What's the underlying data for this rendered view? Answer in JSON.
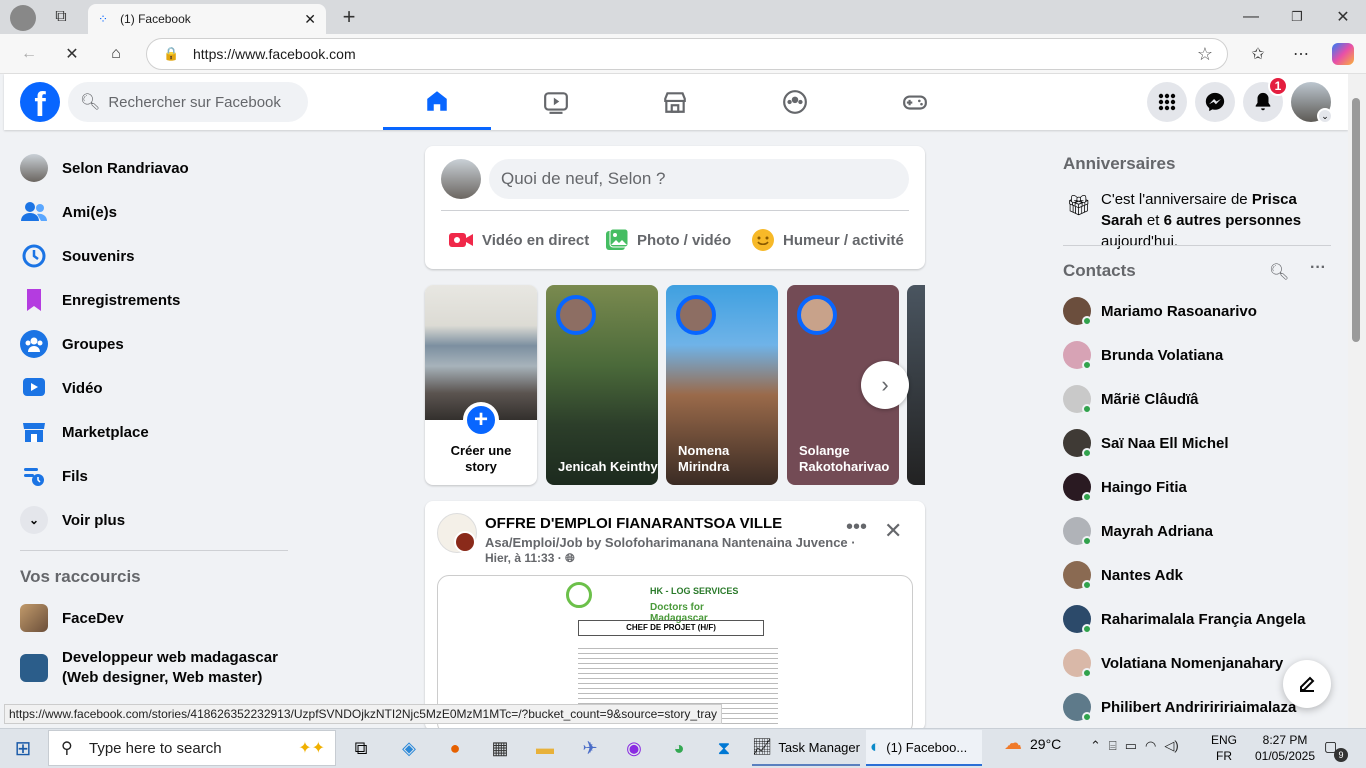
{
  "browser": {
    "tab_title": "(1) Facebook",
    "url": "https://www.facebook.com",
    "status_url": "https://www.facebook.com/stories/418626352232913/UzpfSVNDOjkzNTI2Njc5MzE0MzM1MTc=/?bucket_count=9&source=story_tray"
  },
  "header": {
    "search_placeholder": "Rechercher sur Facebook",
    "notification_count": "1",
    "active_tab": "home"
  },
  "sidebar": {
    "items": [
      {
        "label": "Selon Randriavao",
        "icon": "avatar"
      },
      {
        "label": "Ami(e)s",
        "icon": "friends-icon"
      },
      {
        "label": "Souvenirs",
        "icon": "memories-icon"
      },
      {
        "label": "Enregistrements",
        "icon": "saved-icon"
      },
      {
        "label": "Groupes",
        "icon": "groups-icon"
      },
      {
        "label": "Vidéo",
        "icon": "video-icon"
      },
      {
        "label": "Marketplace",
        "icon": "marketplace-icon"
      },
      {
        "label": "Fils",
        "icon": "feeds-icon"
      },
      {
        "label": "Voir plus",
        "icon": "chevron-down-icon"
      }
    ],
    "shortcuts_title": "Vos raccourcis",
    "shortcuts": [
      {
        "label": "FaceDev"
      },
      {
        "label": "Developpeur web madagascar (Web designer, Web master)"
      }
    ]
  },
  "composer": {
    "placeholder": "Quoi de neuf, Selon ?",
    "live_label": "Vidéo en direct",
    "photo_label": "Photo / vidéo",
    "feeling_label": "Humeur / activité"
  },
  "stories": [
    {
      "name": "Créer une story"
    },
    {
      "name": "Jenicah Keinthy"
    },
    {
      "name": "Nomena Mirindra"
    },
    {
      "name": "Solange Rakotoharivao"
    }
  ],
  "post": {
    "title": "OFFRE D'EMPLOI FIANARANTSOA VILLE",
    "author": "Asa/Emploi/Job by Solofoharimanana Nantenaina Juvence",
    "time": "Hier, à 11:33",
    "image_header": "HK - LOG SERVICES",
    "image_subheader": "Doctors for Madagascar",
    "image_job": "CHEF DE PROJET (H/F)"
  },
  "right": {
    "birthdays_title": "Anniversaires",
    "birthday_text_a": "C'est l'anniversaire de ",
    "birthday_name": "Prisca Sarah",
    "birthday_text_b": " et ",
    "birthday_others": "6 autres personnes",
    "birthday_text_c": " aujourd'hui.",
    "contacts_title": "Contacts",
    "contacts": [
      "Mariamo Rasoanarivo",
      "Brunda Volatiana",
      "Mãrië Clâudïâ",
      "Saï Naa Ell Michel",
      "Haingo Fitia",
      "Mayrah Adriana",
      "Nantes Adk",
      "Raharimalala Françia Angela",
      "Volatiana Nomenjanahary",
      "Philibert Andririririaimalaza"
    ]
  },
  "taskbar": {
    "search_placeholder": "Type here to search",
    "task_manager": "Task Manager",
    "edge_label": "(1) Faceboo...",
    "weather": "29°C",
    "lang_top": "ENG",
    "lang_bottom": "FR",
    "time": "8:27 PM",
    "date": "01/05/2025",
    "notif_count": "9"
  },
  "colors": {
    "fb_blue": "#0866ff",
    "bg": "#f0f2f5"
  }
}
